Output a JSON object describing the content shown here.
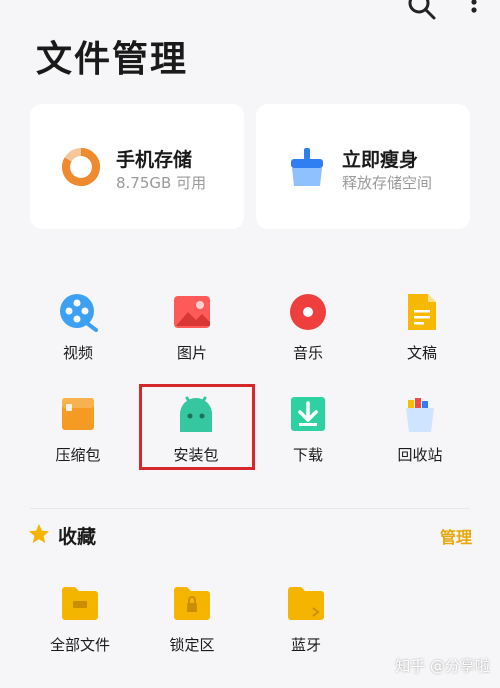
{
  "header": {
    "title": "文件管理"
  },
  "cards": {
    "storage": {
      "title": "手机存储",
      "subtitle": "8.75GB  可用"
    },
    "cleanup": {
      "title": "立即瘦身",
      "subtitle": "释放存储空间"
    }
  },
  "categories": [
    {
      "label": "视频",
      "icon": "video-icon"
    },
    {
      "label": "图片",
      "icon": "image-icon"
    },
    {
      "label": "音乐",
      "icon": "music-icon"
    },
    {
      "label": "文稿",
      "icon": "document-icon"
    },
    {
      "label": "压缩包",
      "icon": "archive-icon"
    },
    {
      "label": "安装包",
      "icon": "android-apk-icon"
    },
    {
      "label": "下载",
      "icon": "download-icon"
    },
    {
      "label": "回收站",
      "icon": "trash-icon"
    }
  ],
  "favorites": {
    "title": "收藏",
    "manage_label": "管理",
    "items": [
      {
        "label": "全部文件",
        "icon": "folder-icon"
      },
      {
        "label": "锁定区",
        "icon": "locked-folder-icon"
      },
      {
        "label": "蓝牙",
        "icon": "bluetooth-folder-icon"
      }
    ]
  },
  "watermark": "知乎 @分享啦",
  "colors": {
    "accent": "#e8a80c",
    "highlight": "#d6282c",
    "background": "#f6f6f8"
  }
}
